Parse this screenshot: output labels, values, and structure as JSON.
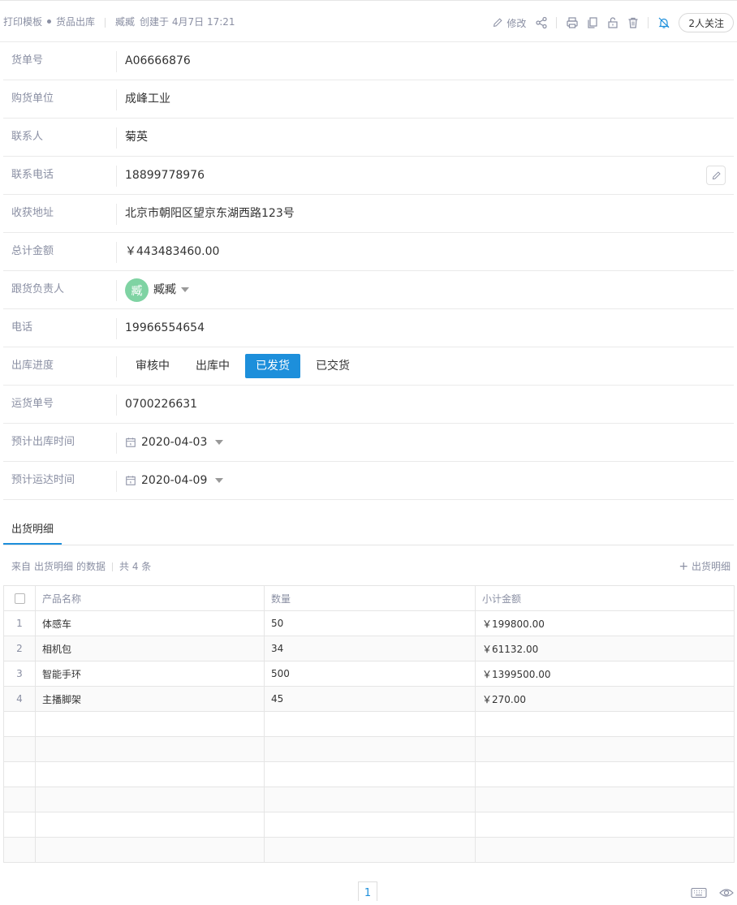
{
  "header": {
    "crumb1": "打印模板",
    "crumb2": "货品出库",
    "owner": "臧臧",
    "created": "创建于 4月7日 17:21",
    "edit_label": "修改",
    "follow_label": "2人关注"
  },
  "fields": {
    "order_no": {
      "label": "货单号",
      "value": "A06666876"
    },
    "buyer": {
      "label": "购货单位",
      "value": "成峰工业"
    },
    "contact": {
      "label": "联系人",
      "value": "菊英"
    },
    "contact_phone": {
      "label": "联系电话",
      "value": "18899778976"
    },
    "address": {
      "label": "收获地址",
      "value": "北京市朝阳区望京东湖西路123号"
    },
    "total": {
      "label": "总计金额",
      "value": "￥443483460.00"
    },
    "manager": {
      "label": "跟货负责人",
      "avatar": "臧",
      "value": "臧臧"
    },
    "phone": {
      "label": "电话",
      "value": "19966554654"
    },
    "progress": {
      "label": "出库进度",
      "steps": [
        "审核中",
        "出库中",
        "已发货",
        "已交货"
      ],
      "active_index": 2
    },
    "tracking": {
      "label": "运货单号",
      "value": "0700226631"
    },
    "out_date": {
      "label": "预计出库时间",
      "value": "2020-04-03"
    },
    "arrive_date": {
      "label": "预计运达时间",
      "value": "2020-04-09"
    }
  },
  "detail": {
    "tab_label": "出货明细",
    "source_prefix": "来自",
    "source_link": "出货明细",
    "source_suffix": "的数据",
    "count_text": "共 4 条",
    "add_label": "出货明细",
    "columns": [
      "产品名称",
      "数量",
      "小计金额"
    ],
    "rows": [
      {
        "index": "1",
        "name": "体感车",
        "qty": "50",
        "amount": "￥199800.00"
      },
      {
        "index": "2",
        "name": "相机包",
        "qty": "34",
        "amount": "￥61132.00"
      },
      {
        "index": "3",
        "name": "智能手环",
        "qty": "500",
        "amount": "￥1399500.00"
      },
      {
        "index": "4",
        "name": "主播脚架",
        "qty": "45",
        "amount": "￥270.00"
      }
    ]
  },
  "pager": {
    "current": "1"
  },
  "colors": {
    "accent": "#1d8fdb",
    "label": "#8a8fa3",
    "avatar": "#7fd3a3",
    "border": "#eaeaea"
  }
}
